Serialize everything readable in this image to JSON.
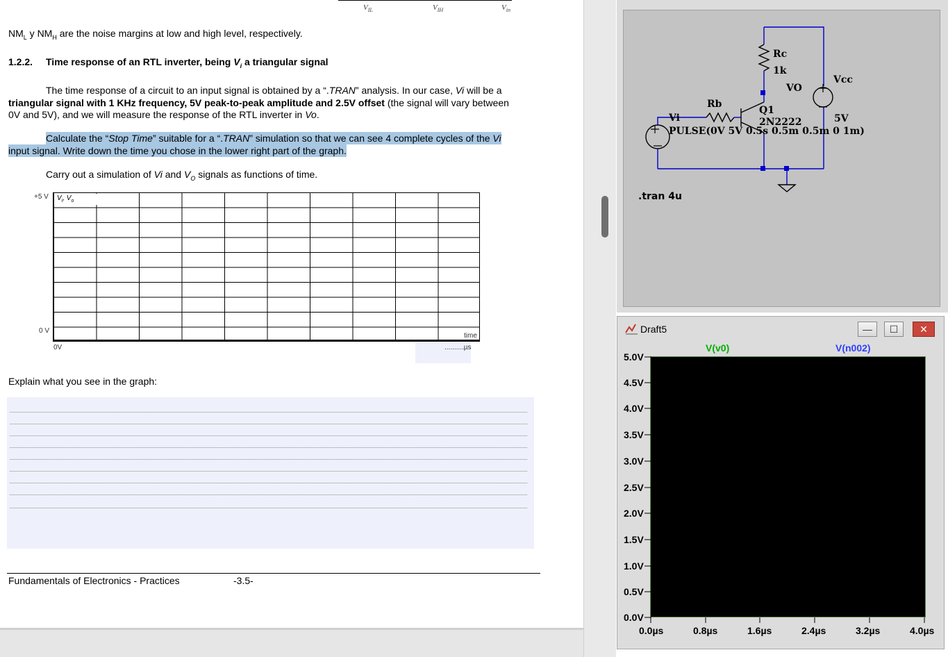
{
  "document": {
    "axis_ticks": [
      "V",
      "IL",
      "V",
      "IH",
      "V",
      "in"
    ],
    "noise_margin_prefix": "NM",
    "noise_margin_sub_l": "L",
    "noise_margin_mid": " y NM",
    "noise_margin_sub_h": "H",
    "noise_margin_rest": " are the noise margins at low and high level, respectively.",
    "section_number": "1.2.2.",
    "section_title_pre": "Time response of an RTL inverter, being ",
    "section_title_var": "V",
    "section_title_sub": "i",
    "section_title_post": " a triangular signal",
    "para1_line1_pre": "The time response of a circuit to an input signal is obtained by a “.",
    "para1_line1_tran": "TRAN",
    "para1_line1_mid": "” analysis. In our case, ",
    "para1_line1_vi": "Vi",
    "para1_line1_post": " will be a",
    "para1_line2_bold": "triangular signal with 1 KHz frequency, 5V peak-to-peak amplitude and 2.5V offset",
    "para1_line2_post": " (the signal will vary between",
    "para1_line3_pre": "0V and 5V), and we will measure the response of the RTL inverter in ",
    "para1_line3_vo": "Vo",
    "para1_line3_post": ".",
    "para2_line1_pre": "Calculate the “",
    "para2_line1_st": "Stop Time",
    "para2_line1_mid": "” suitable for a “.",
    "para2_line1_tran": "TRAN",
    "para2_line1_post": "” simulation so that we can see 4 complete cycles of the ",
    "para2_line1_vi": "Vi",
    "para2_line2": "input signal. Write down the time you chose in the lower right part of the graph.",
    "para3_pre": "Carry out a simulation of ",
    "para3_vi": "Vi",
    "para3_mid": " and ",
    "para3_vo": "V",
    "para3_vo_sub": "O",
    "para3_post": " signals as functions of time.",
    "grid_top_value": "+5 V",
    "grid_label": "V",
    "grid_label_sub1": "i",
    "grid_label_sep": ", V",
    "grid_label_sub2": "o",
    "grid_zero_value": "0 V",
    "grid_origin": "0V",
    "grid_time_label": "time",
    "grid_time_unit": "..........µs",
    "explain_prompt": "Explain what you see in the graph:",
    "footer_title": "Fundamentals of Electronics - Practices",
    "footer_page": "-3.5-"
  },
  "schematic": {
    "rc_label": "Rc",
    "rc_value": "1k",
    "vcc_label": "Vcc",
    "vo_label": "VO",
    "rb_label": "Rb",
    "q1_label": "Q1",
    "vi_label": "Vi",
    "vcc_value": "5V",
    "pulse_text": "PULSE(0V 5V 0.5s 0.5m 0.5m 0 1m)",
    "transistor_model": "2N2222",
    "tran_directive": ".tran 4u"
  },
  "waveform": {
    "window_title": "Draft5",
    "trace_names": [
      "V(v0)",
      "V(n002)"
    ],
    "trace_colors": [
      "#00b000",
      "#2f40ff"
    ],
    "y_ticks": [
      "5.0V",
      "4.5V",
      "4.0V",
      "3.5V",
      "3.0V",
      "2.5V",
      "2.0V",
      "1.5V",
      "1.0V",
      "0.5V",
      "0.0V"
    ],
    "x_ticks": [
      "0.0µs",
      "0.8µs",
      "1.6µs",
      "2.4µs",
      "3.2µs",
      "4.0µs"
    ],
    "minimize_label": "—",
    "maximize_label": "☐",
    "close_label": "✕"
  }
}
